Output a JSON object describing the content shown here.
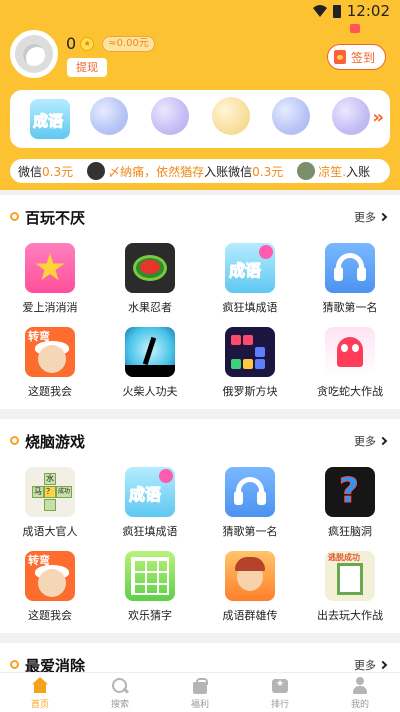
{
  "status_bar": {
    "time": "12:02"
  },
  "header": {
    "coins": "0",
    "coin_symbol": "★",
    "money": "≈0.00元",
    "withdraw_label": "提现",
    "signin_label": "签到"
  },
  "recent": {
    "first_icon_text": "成语",
    "more_arrow": "»"
  },
  "ticker": {
    "seg1_prefix": "微信",
    "seg1_amount": "0.3元",
    "seg2_user": "〆納痛，依然猶存",
    "seg2_mid": "入账微信",
    "seg2_amount": "0.3元",
    "seg3_user": "凉笙.",
    "seg3_suffix": "入账"
  },
  "sections": [
    {
      "title": "百玩不厌",
      "more": "更多",
      "games": [
        {
          "name": "爱上消消消",
          "icon": "star-match-icon"
        },
        {
          "name": "水果忍者",
          "icon": "watermelon-icon"
        },
        {
          "name": "疯狂填成语",
          "icon": "idiom-icon",
          "icon_text": "成语"
        },
        {
          "name": "猜歌第一名",
          "icon": "headphones-icon"
        },
        {
          "name": "这题我会",
          "icon": "professor-icon",
          "icon_text": "转弯"
        },
        {
          "name": "火柴人功夫",
          "icon": "stickman-icon"
        },
        {
          "name": "俄罗斯方块",
          "icon": "tetris-icon"
        },
        {
          "name": "贪吃蛇大作战",
          "icon": "snake-ghost-icon"
        }
      ]
    },
    {
      "title": "烧脑游戏",
      "more": "更多",
      "games": [
        {
          "name": "成语大官人",
          "icon": "idiom-grid-icon",
          "cells": [
            "水",
            "马",
            "？",
            "成功"
          ]
        },
        {
          "name": "疯狂填成语",
          "icon": "idiom-icon",
          "icon_text": "成语"
        },
        {
          "name": "猜歌第一名",
          "icon": "headphones-icon"
        },
        {
          "name": "疯狂脑洞",
          "icon": "brain-question-icon",
          "icon_text": "?"
        },
        {
          "name": "这题我会",
          "icon": "professor-icon",
          "icon_text": "转弯"
        },
        {
          "name": "欢乐猜字",
          "icon": "word-grid-icon"
        },
        {
          "name": "成语群雄传",
          "icon": "hero-icon"
        },
        {
          "name": "出去玩大作战",
          "icon": "escape-icon",
          "icon_text": "逃脱成功"
        }
      ]
    },
    {
      "title": "最爱消除",
      "more": "更多"
    }
  ],
  "nav": [
    {
      "label": "首页",
      "icon": "home-icon",
      "active": true
    },
    {
      "label": "搜索",
      "icon": "search-icon"
    },
    {
      "label": "福利",
      "icon": "gift-icon"
    },
    {
      "label": "排行",
      "icon": "rank-icon"
    },
    {
      "label": "我的",
      "icon": "profile-icon"
    }
  ],
  "colors": {
    "brand": "#fcc232",
    "accent": "#f0642b",
    "money": "#f08a1a",
    "active_nav": "#f6a31c"
  }
}
